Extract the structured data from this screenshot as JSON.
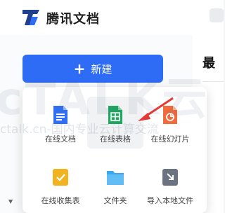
{
  "header": {
    "app_title": "腾讯文档",
    "logo_icon": "tencent-docs-logo"
  },
  "main": {
    "heading": "最"
  },
  "sidebar": {
    "new_button_label": "新建",
    "new_button_icon": "plus-icon",
    "bottom_chevron": "▼"
  },
  "new_menu": {
    "items": [
      {
        "label": "在线文档",
        "icon": "online-doc-icon",
        "color": "#2f6ef5"
      },
      {
        "label": "在线表格",
        "icon": "online-sheet-icon",
        "color": "#1ea760"
      },
      {
        "label": "在线幻灯片",
        "icon": "online-slides-icon",
        "color": "#f26b3a"
      },
      {
        "label": "在线收集表",
        "icon": "online-form-icon",
        "color": "#f2b320"
      },
      {
        "label": "文件夹",
        "icon": "folder-icon",
        "color": "#3aa8f0"
      },
      {
        "label": "导入本地文件",
        "icon": "import-icon",
        "color": "#6b7280"
      }
    ]
  },
  "watermark": {
    "big_text": "cTALK云",
    "small_text": "ctalk.cn-国内专业云计算交流"
  },
  "accent_color": "#2e6cf6",
  "annotation_color": "#e53935"
}
